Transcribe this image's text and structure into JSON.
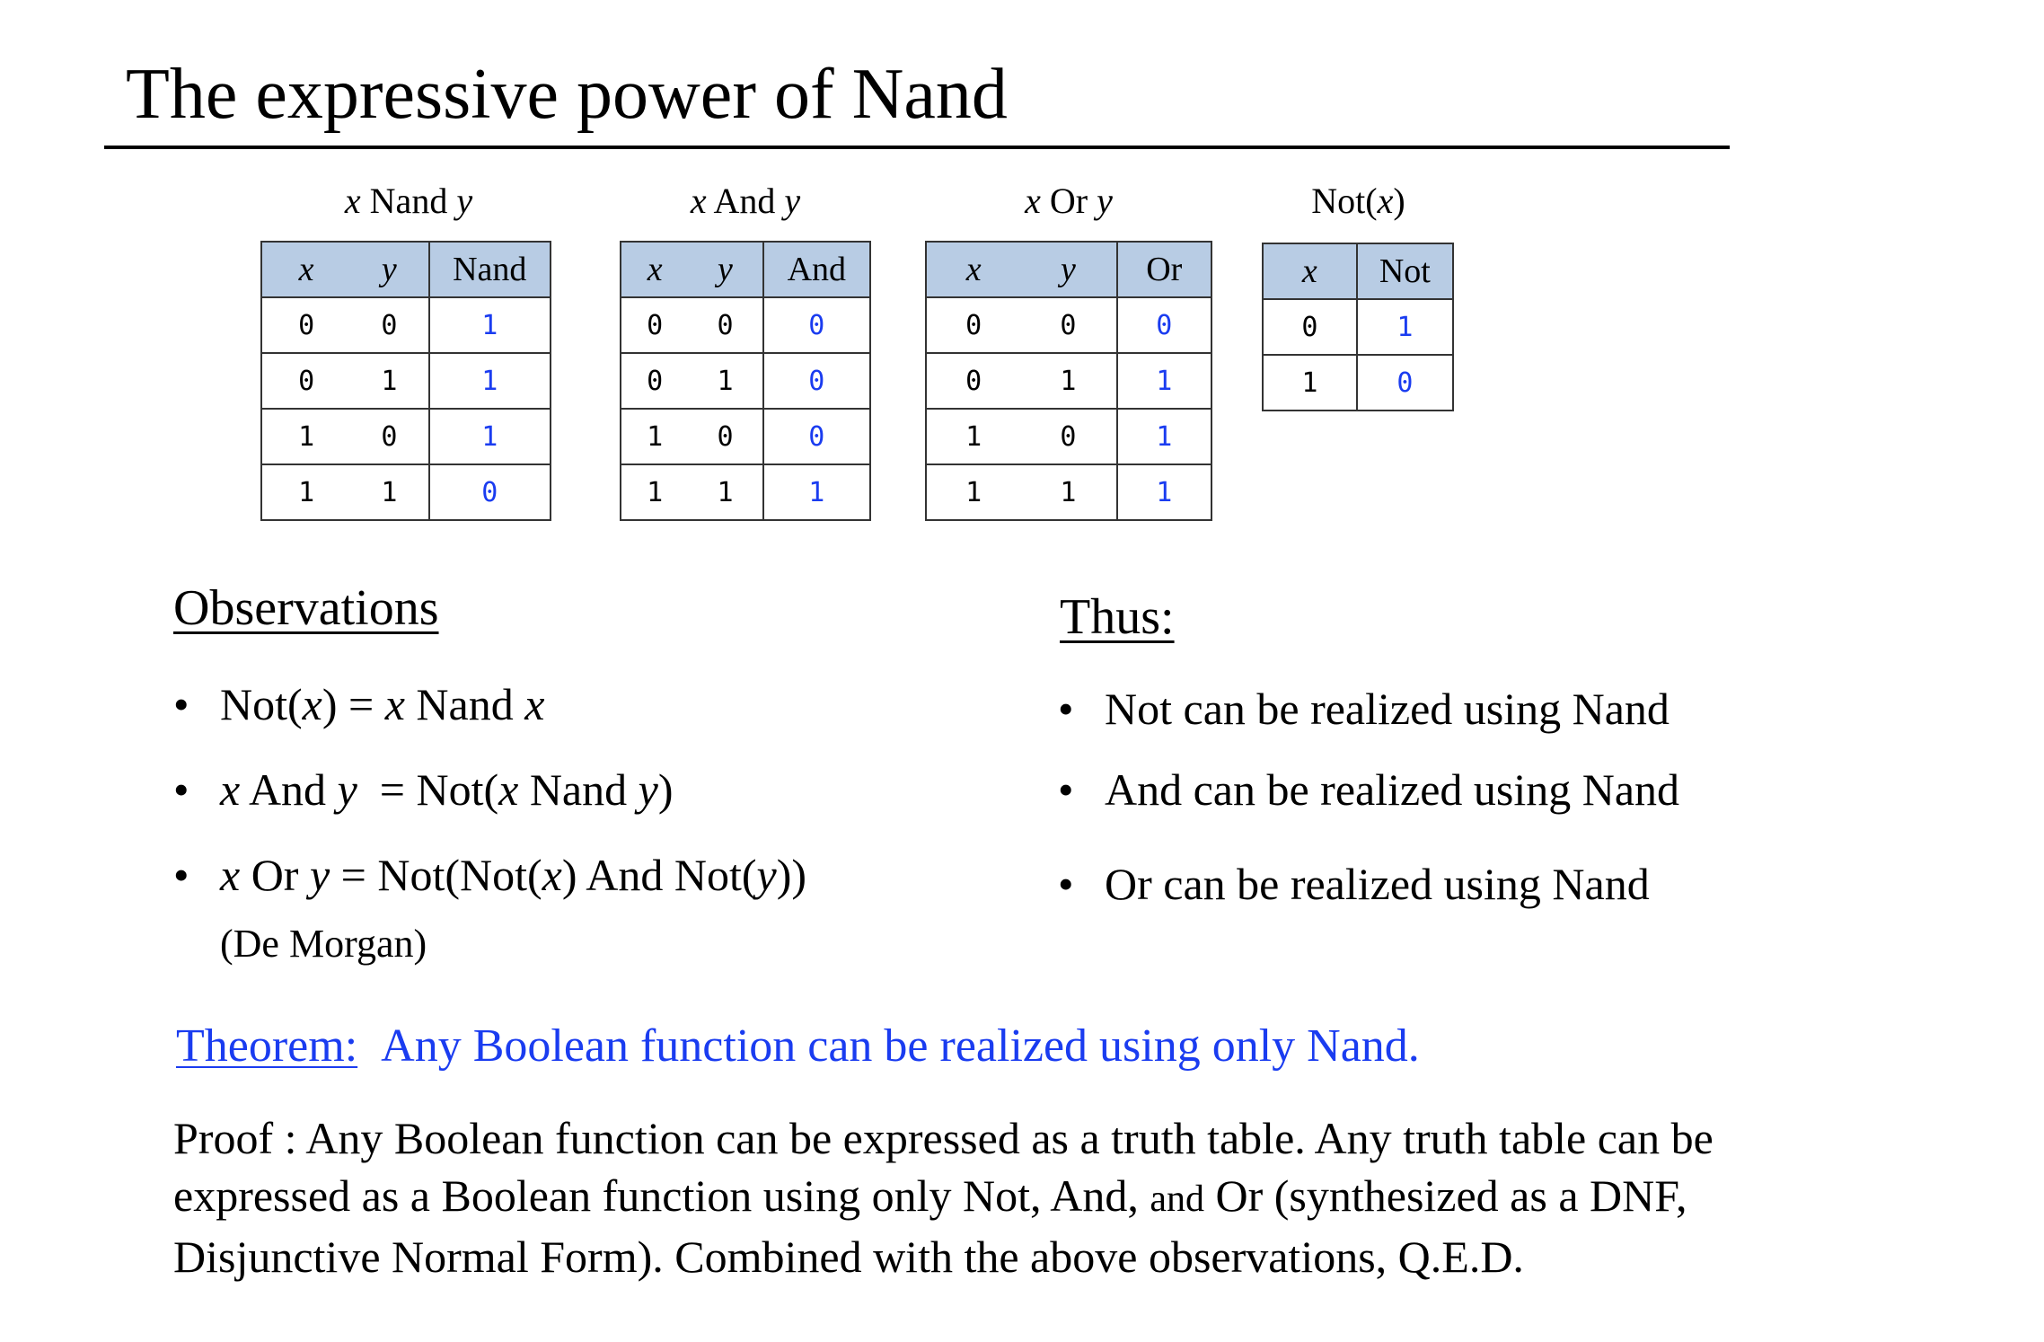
{
  "title": "The expressive power of Nand",
  "tables": {
    "nand": {
      "caption_var1": "x",
      "caption_op": "Nand",
      "caption_var2": "y",
      "headers": [
        "x",
        "y",
        "Nand"
      ],
      "rows": [
        [
          "0",
          "0",
          "1"
        ],
        [
          "0",
          "1",
          "1"
        ],
        [
          "1",
          "0",
          "1"
        ],
        [
          "1",
          "1",
          "0"
        ]
      ]
    },
    "and": {
      "caption_var1": "x",
      "caption_op": "And",
      "caption_var2": "y",
      "headers": [
        "x",
        "y",
        "And"
      ],
      "rows": [
        [
          "0",
          "0",
          "0"
        ],
        [
          "0",
          "1",
          "0"
        ],
        [
          "1",
          "0",
          "0"
        ],
        [
          "1",
          "1",
          "1"
        ]
      ]
    },
    "or": {
      "caption_var1": "x",
      "caption_op": "Or",
      "caption_var2": "y",
      "headers": [
        "x",
        "y",
        "Or"
      ],
      "rows": [
        [
          "0",
          "0",
          "0"
        ],
        [
          "0",
          "1",
          "1"
        ],
        [
          "1",
          "0",
          "1"
        ],
        [
          "1",
          "1",
          "1"
        ]
      ]
    },
    "not": {
      "caption_pre": "Not(",
      "caption_var": "x",
      "caption_post": ")",
      "headers": [
        "x",
        "Not"
      ],
      "rows": [
        [
          "0",
          "1"
        ],
        [
          "1",
          "0"
        ]
      ]
    }
  },
  "observations": {
    "heading": "Observations",
    "bullet": "•",
    "items": [
      {
        "a": "Not(",
        "b": "x",
        "c": ") = ",
        "d": "x",
        "e": " Nand ",
        "f": "x"
      },
      {
        "a": "x",
        "b": " And ",
        "c": "y",
        "d": "  = Not(",
        "e": "x",
        "f": " Nand ",
        "g": "y",
        "h": ")"
      },
      {
        "a": "x",
        "b": " Or ",
        "c": "y",
        "d": " = Not(Not(",
        "e": "x",
        "f": ") And Not(",
        "g": "y",
        "h": "))"
      }
    ],
    "note": "(De Morgan)"
  },
  "thus": {
    "heading": "Thus:",
    "items": [
      "Not can be realized using Nand",
      "And can be realized using Nand",
      "Or can be realized using Nand"
    ]
  },
  "theorem": {
    "label": "Theorem:",
    "text": "Any Boolean function can be realized using only Nand."
  },
  "proof": {
    "part1": "Proof : Any Boolean function can be expressed as a truth table. Any truth table can be expressed as a Boolean function using only Not, And, ",
    "and_word": "and",
    "part2": " Or (synthesized as a DNF, Disjunctive Normal Form). Combined with the above observations, Q.E.D."
  },
  "colors": {
    "header_fill": "#b8cce4",
    "output_values": "#1a3cf0",
    "theorem_text": "#1a3cf0"
  }
}
